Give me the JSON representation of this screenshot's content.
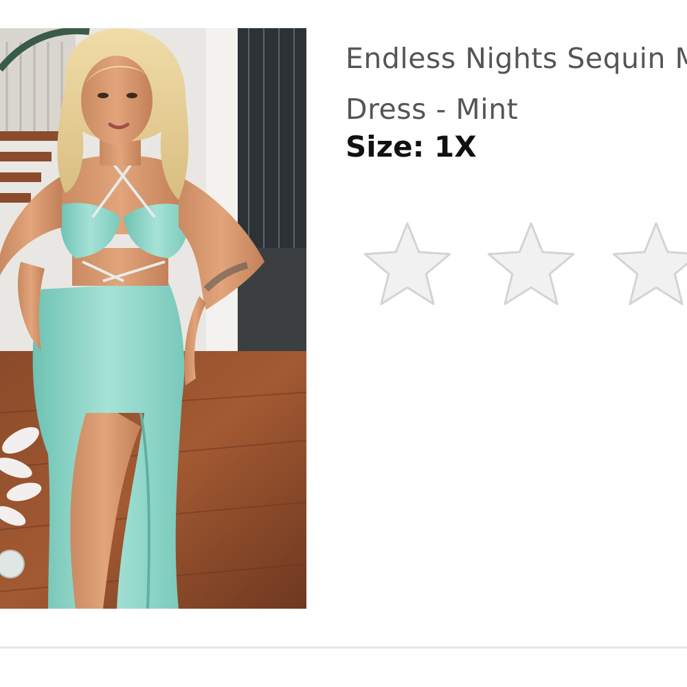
{
  "product": {
    "title": "Endless Nights Sequin Maxi Dress - Mint",
    "size_label": "Size:",
    "size_value": "1X",
    "image_icon": "product-photo",
    "image_alt": "Endless Nights Sequin Maxi Dress - Mint"
  },
  "rating": {
    "value": 0,
    "max": 5,
    "icon": "star-outline-icon",
    "empty_color": "#f1f1f1",
    "outline_color": "#d3d3d3"
  },
  "colors": {
    "title_text": "#555555",
    "size_text": "#111111",
    "divider": "#e6e6e6",
    "dress": "#8fd3c6"
  }
}
